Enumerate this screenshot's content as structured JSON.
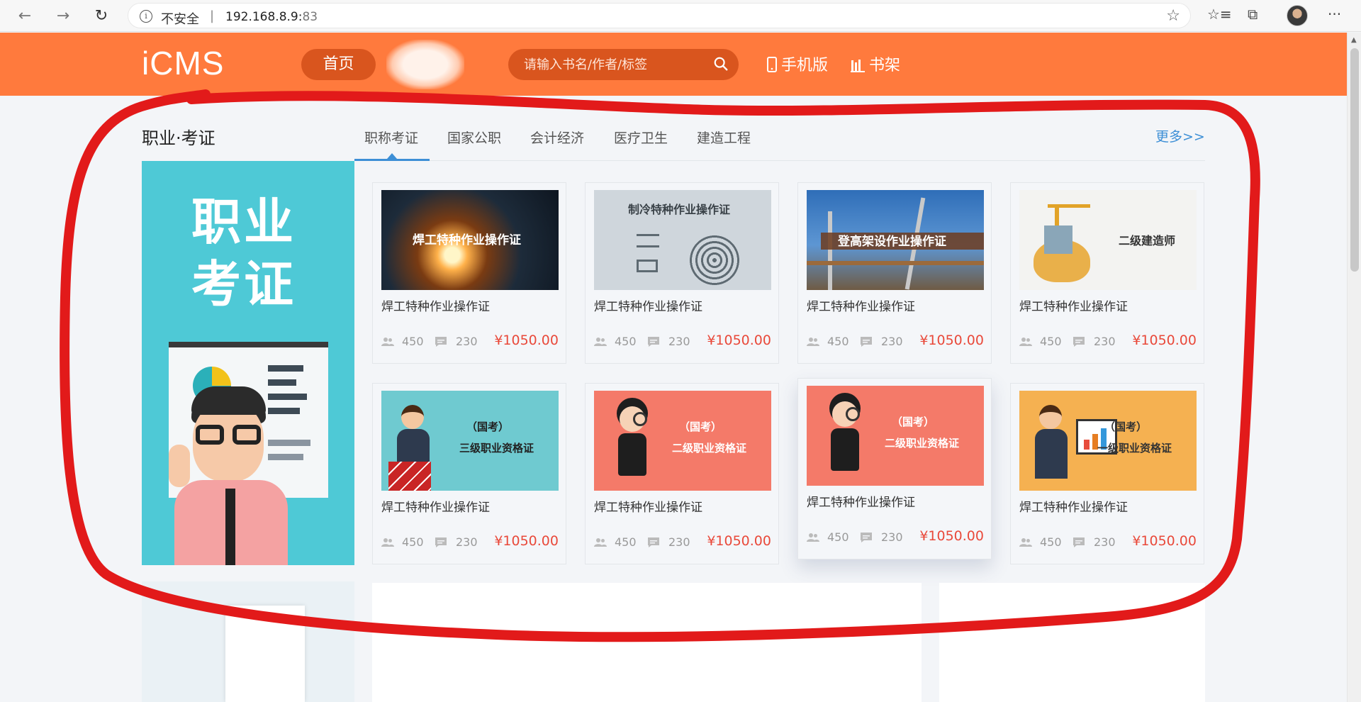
{
  "browser": {
    "security_label": "不安全",
    "separator": "|",
    "url_host": "192.168.8.9:",
    "url_port": "83",
    "info_glyph": "i",
    "back_glyph": "←",
    "forward_glyph": "→",
    "reload_glyph": "↻",
    "star_glyph": "☆",
    "favorites_glyph": "☆≡",
    "collections_glyph": "⧉",
    "menu_glyph": "···"
  },
  "header": {
    "logo": "iCMS",
    "home_label": "首页",
    "search_placeholder": "请输入书名/作者/标签",
    "mobile_label": "手机版",
    "shelf_label": "书架",
    "brand_color": "#ff7a3d"
  },
  "section": {
    "title": "职业·考证",
    "tabs": [
      "职称考证",
      "国家公职",
      "会计经济",
      "医疗卫生",
      "建造工程"
    ],
    "active_tab": 0,
    "more_label": "更多>>",
    "accent_color": "#3d8fd6"
  },
  "banner": {
    "line1": "职业",
    "line2": "考证",
    "bg_color": "#4ec9d6"
  },
  "cards": [
    {
      "name": "焊工特种作业操作证",
      "students": "450",
      "comments": "230",
      "price": "¥1050.00",
      "image_caption": "焊工特种作业操作证",
      "image_theme": "welding"
    },
    {
      "name": "焊工特种作业操作证",
      "students": "450",
      "comments": "230",
      "price": "¥1050.00",
      "image_caption": "制冷特种作业操作证",
      "image_theme": "refrigeration"
    },
    {
      "name": "焊工特种作业操作证",
      "students": "450",
      "comments": "230",
      "price": "¥1050.00",
      "image_caption": "登高架设作业操作证",
      "image_theme": "scaffolding"
    },
    {
      "name": "焊工特种作业操作证",
      "students": "450",
      "comments": "230",
      "price": "¥1050.00",
      "image_caption": "二级建造师",
      "image_theme": "construction"
    },
    {
      "name": "焊工特种作业操作证",
      "students": "450",
      "comments": "230",
      "price": "¥1050.00",
      "image_caption": "（国考）",
      "image_caption2": "三级职业资格证",
      "image_theme": "teal-businessman"
    },
    {
      "name": "焊工特种作业操作证",
      "students": "450",
      "comments": "230",
      "price": "¥1050.00",
      "image_caption": "（国考）",
      "image_caption2": "二级职业资格证",
      "image_theme": "coral-woman"
    },
    {
      "name": "焊工特种作业操作证",
      "students": "450",
      "comments": "230",
      "price": "¥1050.00",
      "image_caption": "（国考）",
      "image_caption2": "二级职业资格证",
      "image_theme": "coral-woman-hover"
    },
    {
      "name": "焊工特种作业操作证",
      "students": "450",
      "comments": "230",
      "price": "¥1050.00",
      "image_caption": "（国考）",
      "image_caption2": "一级职业资格证",
      "image_theme": "orange-presenter"
    }
  ],
  "price_color": "#e9493a",
  "annotation_color": "#e21a1a"
}
